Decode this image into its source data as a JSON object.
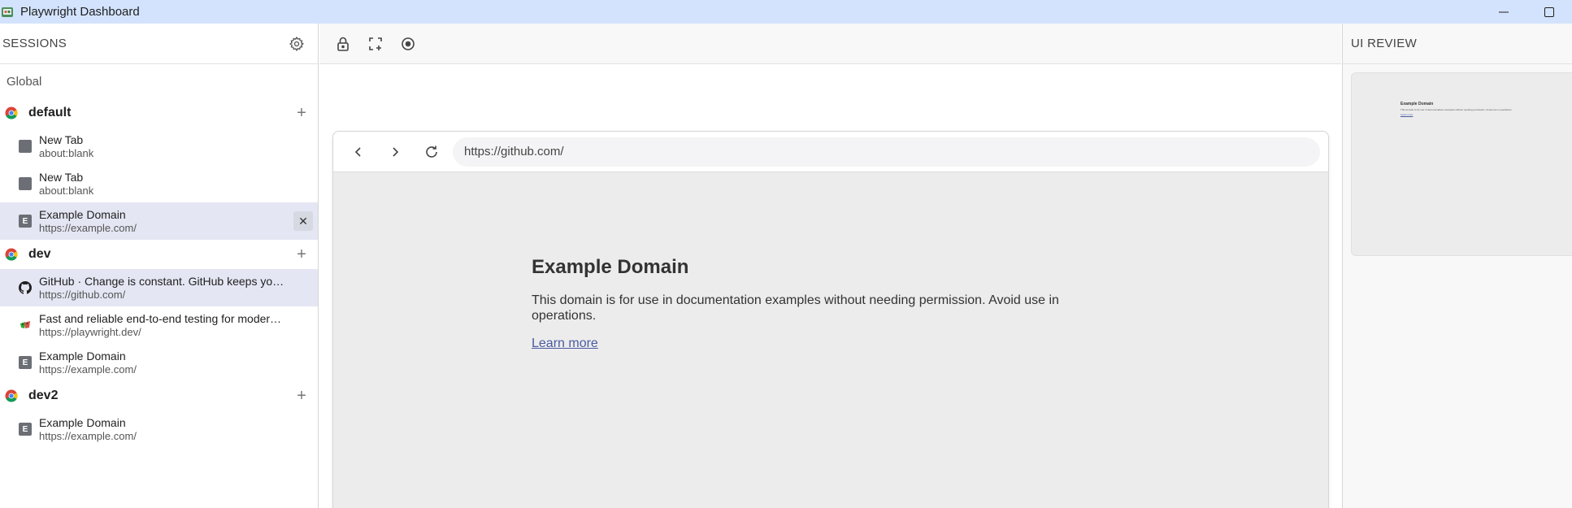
{
  "window": {
    "title": "Playwright Dashboard"
  },
  "sidebar": {
    "title": "SESSIONS",
    "global_label": "Global",
    "sessions": [
      {
        "name": "default",
        "tabs": [
          {
            "title": "New Tab",
            "url": "about:blank",
            "icon": "blank-page-icon"
          },
          {
            "title": "New Tab",
            "url": "about:blank",
            "icon": "blank-page-icon"
          },
          {
            "title": "Example Domain",
            "url": "https://example.com/",
            "icon": "letter-e-icon",
            "icon_letter": "E",
            "active": true,
            "close_glyph": "✕"
          }
        ]
      },
      {
        "name": "dev",
        "tabs": [
          {
            "title": "GitHub · Change is constant. GitHub keeps you ahead.",
            "url": "https://github.com/",
            "icon": "github-icon",
            "active": true
          },
          {
            "title": "Fast and reliable end-to-end testing for modern web apps | Playwright",
            "url": "https://playwright.dev/",
            "icon": "playwright-icon"
          },
          {
            "title": "Example Domain",
            "url": "https://example.com/",
            "icon": "letter-e-icon",
            "icon_letter": "E"
          }
        ]
      },
      {
        "name": "dev2",
        "tabs": [
          {
            "title": "Example Domain",
            "url": "https://example.com/",
            "icon": "letter-e-icon",
            "icon_letter": "E"
          }
        ]
      }
    ],
    "add_glyph": "+"
  },
  "toolbar": {
    "icons": [
      "lock-icon",
      "add-frame-icon",
      "record-icon"
    ]
  },
  "browser": {
    "url": "https://github.com/",
    "page": {
      "heading": "Example Domain",
      "paragraph": "This domain is for use in documentation examples without needing permission. Avoid use in operations.",
      "link": "Learn more"
    }
  },
  "review": {
    "title": "UI REVIEW",
    "thumbnail": {
      "heading": "Example Domain",
      "paragraph": "This domain is for use in documentation examples without needing permission. Avoid use in operations.",
      "link": "Learn more"
    }
  },
  "colors": {
    "titlebar": "#d3e3fd",
    "active_row": "#e4e6f3",
    "link": "#4a5ba1"
  }
}
